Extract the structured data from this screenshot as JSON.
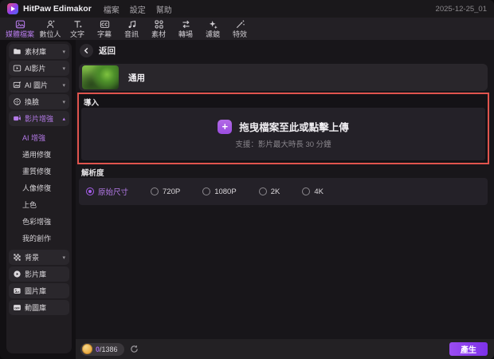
{
  "titlebar": {
    "app_name": "HitPaw Edimakor",
    "menu_items": [
      "檔案",
      "設定",
      "幫助"
    ],
    "project_name": "2025-12-25_01"
  },
  "toolbar": {
    "items": [
      {
        "label": "媒體檔案",
        "icon": "media-icon",
        "active": true
      },
      {
        "label": "數位人",
        "icon": "digital-human-icon",
        "active": false
      },
      {
        "label": "文字",
        "icon": "text-icon",
        "active": false
      },
      {
        "label": "字幕",
        "icon": "subtitle-icon",
        "active": false
      },
      {
        "label": "音訊",
        "icon": "audio-icon",
        "active": false
      },
      {
        "label": "素材",
        "icon": "assets-icon",
        "active": false
      },
      {
        "label": "轉場",
        "icon": "transition-icon",
        "active": false
      },
      {
        "label": "濾鏡",
        "icon": "filter-icon",
        "active": false
      },
      {
        "label": "特效",
        "icon": "effects-icon",
        "active": false
      }
    ]
  },
  "sidebar": {
    "groups": [
      {
        "label": "素材庫",
        "icon": "folder-icon",
        "collapsible": true
      },
      {
        "label": "AI影片",
        "icon": "ai-video-icon",
        "collapsible": true
      },
      {
        "label": "AI 圖片",
        "icon": "ai-image-icon",
        "collapsible": true
      },
      {
        "label": "換臉",
        "icon": "face-swap-icon",
        "collapsible": true
      },
      {
        "label": "影片增強",
        "icon": "video-enhance-icon",
        "collapsible": true,
        "expanded": true,
        "active": true
      },
      {
        "label": "背景",
        "icon": "background-icon",
        "collapsible": true
      },
      {
        "label": "影片庫",
        "icon": "video-library-icon",
        "collapsible": false
      },
      {
        "label": "圖片庫",
        "icon": "image-library-icon",
        "collapsible": false
      },
      {
        "label": "動圖庫",
        "icon": "gif-library-icon",
        "collapsible": false
      }
    ],
    "enhance_subitems": [
      {
        "label": "AI 增強",
        "active": true
      },
      {
        "label": "通用修復",
        "active": false
      },
      {
        "label": "畫質修復",
        "active": false
      },
      {
        "label": "人像修復",
        "active": false
      },
      {
        "label": "上色",
        "active": false
      },
      {
        "label": "色彩增強",
        "active": false
      },
      {
        "label": "我的創作",
        "active": false
      }
    ]
  },
  "content": {
    "back_label": "返回",
    "mode_label": "通用",
    "import": {
      "section_label": "導入",
      "upload_title": "拖曳檔案至此或點擊上傳",
      "upload_hint": "支援：影片最大時長 30 分鐘"
    },
    "resolution": {
      "section_label": "解析度",
      "options": [
        {
          "label": "原始尺寸",
          "selected": true
        },
        {
          "label": "720P",
          "selected": false
        },
        {
          "label": "1080P",
          "selected": false
        },
        {
          "label": "2K",
          "selected": false
        },
        {
          "label": "4K",
          "selected": false
        }
      ]
    },
    "footer": {
      "credits_used": "0",
      "credits_total": "/1386",
      "generate_label": "產生"
    }
  },
  "icons": {
    "caret_down": "▾",
    "caret_up": "▴",
    "plus": "+"
  },
  "colors": {
    "accent": "#8a3ff0",
    "accent_light": "#b47ae8",
    "alert_border": "#e0544e",
    "coin_gold": "#e8a83e",
    "panel_bg": "#242128",
    "sidebar_bg": "#201d21"
  }
}
